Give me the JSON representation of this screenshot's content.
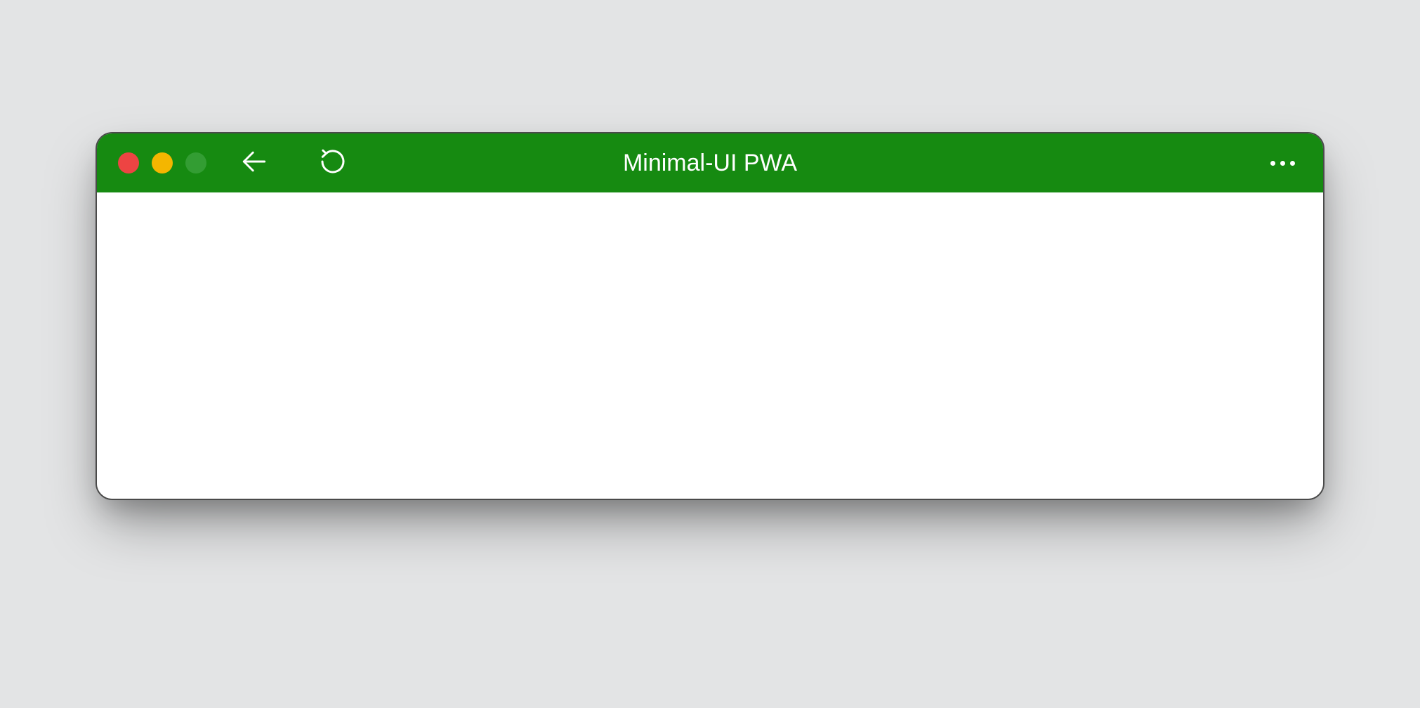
{
  "window": {
    "title": "Minimal-UI PWA"
  },
  "colors": {
    "titlebar_bg": "#168a11",
    "close": "#ed4443",
    "minimize": "#f4b600",
    "maximize": "#339d33"
  }
}
